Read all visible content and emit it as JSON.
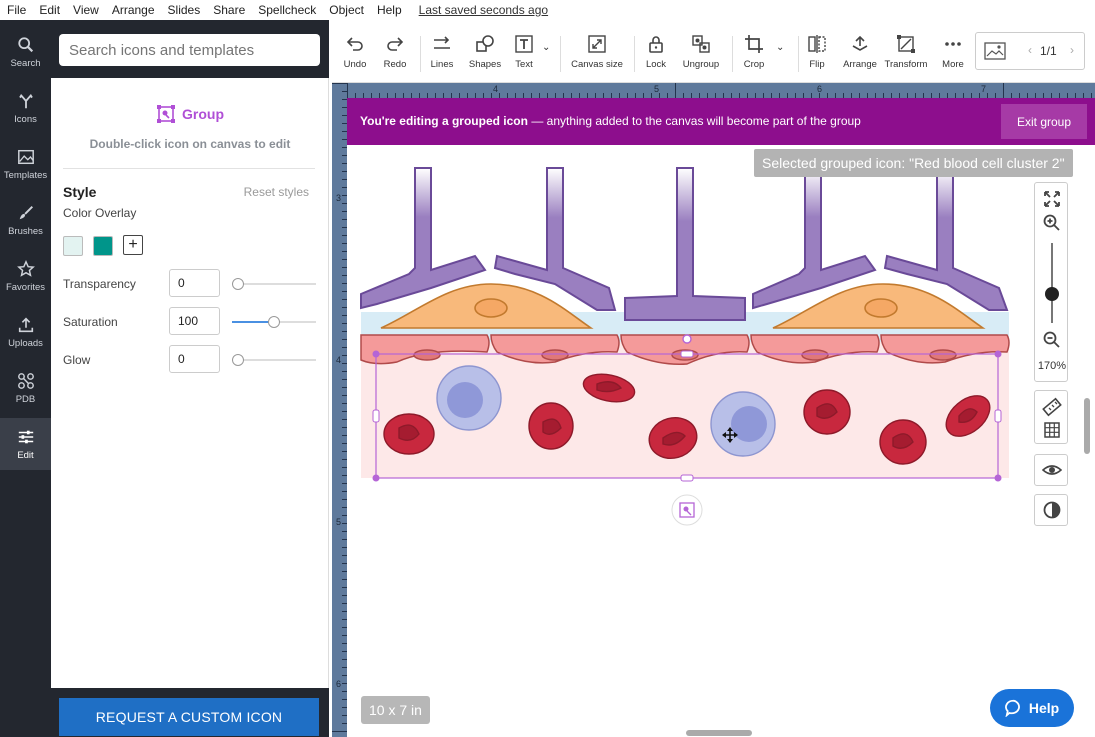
{
  "menubar": {
    "items": [
      "File",
      "Edit",
      "View",
      "Arrange",
      "Slides",
      "Share",
      "Spellcheck",
      "Object",
      "Help"
    ],
    "saved_status": "Last saved seconds ago"
  },
  "rail": {
    "items": [
      {
        "label": "Search",
        "icon": "search-icon"
      },
      {
        "label": "Icons",
        "icon": "antibody-icon"
      },
      {
        "label": "Templates",
        "icon": "image-icon"
      },
      {
        "label": "Brushes",
        "icon": "brush-icon"
      },
      {
        "label": "Favorites",
        "icon": "star-icon"
      },
      {
        "label": "Uploads",
        "icon": "upload-icon"
      },
      {
        "label": "PDB",
        "icon": "molecule-icon"
      },
      {
        "label": "Edit",
        "icon": "sliders-icon"
      }
    ],
    "active": "Edit"
  },
  "panel": {
    "search_placeholder": "Search icons and templates",
    "group_title": "Group",
    "group_subtitle": "Double-click icon on canvas to edit",
    "style_title": "Style",
    "reset_label": "Reset styles",
    "overlay_label": "Color Overlay",
    "swatches": [
      "#e3f3f1",
      "#00958a"
    ],
    "add_swatch": "+",
    "props": [
      {
        "label": "Transparency",
        "value": "0",
        "level": 0
      },
      {
        "label": "Saturation",
        "value": "100",
        "level": 0.5
      },
      {
        "label": "Glow",
        "value": "0",
        "level": 0
      }
    ],
    "request_button": "REQUEST A CUSTOM ICON"
  },
  "toolbar": {
    "tools": [
      {
        "label": "Undo",
        "icon": "undo-icon"
      },
      {
        "label": "Redo",
        "icon": "redo-icon"
      },
      {
        "label": "Lines",
        "icon": "lines-icon"
      },
      {
        "label": "Shapes",
        "icon": "shapes-icon"
      },
      {
        "label": "Text",
        "icon": "text-icon"
      },
      {
        "label": "Canvas size",
        "icon": "canvas-size-icon"
      },
      {
        "label": "Lock",
        "icon": "lock-icon"
      },
      {
        "label": "Ungroup",
        "icon": "ungroup-icon"
      },
      {
        "label": "Crop",
        "icon": "crop-icon"
      },
      {
        "label": "Flip",
        "icon": "flip-icon"
      },
      {
        "label": "Arrange",
        "icon": "arrange-icon"
      },
      {
        "label": "Transform",
        "icon": "transform-icon"
      },
      {
        "label": "More",
        "icon": "more-icon"
      }
    ],
    "page_indicator": "1/1",
    "prev": "‹",
    "next": "›"
  },
  "rulers": {
    "h_labels": [
      "4",
      "5",
      "6",
      "7"
    ],
    "v_labels": [
      "3",
      "4",
      "5",
      "6"
    ]
  },
  "canvas": {
    "banner_bold": "You're editing a grouped icon",
    "banner_rest": " — anything added to the canvas will become part of the group",
    "exit_button": "Exit group",
    "tooltip": "Selected grouped icon: \"Red blood cell cluster 2\"",
    "zoom_value": "170%",
    "canvas_size": "10 x 7 in",
    "help_label": "Help"
  },
  "colors": {
    "banner": "#8d0e8d",
    "accent": "#b04fd6",
    "rail": "#23272f",
    "help": "#1a73d9"
  }
}
